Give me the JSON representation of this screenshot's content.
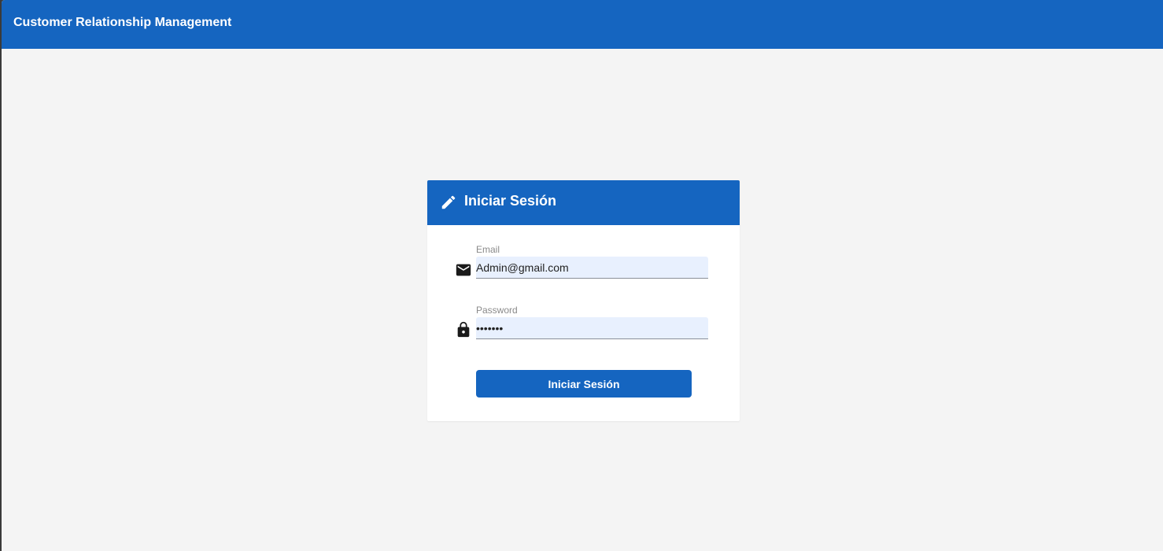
{
  "app": {
    "title": "Customer Relationship Management",
    "accent_color": "#1565c0",
    "background_color": "#f4f4f4"
  },
  "login_card": {
    "title": "Iniciar Sesión",
    "header_icon": "pencil-icon",
    "email": {
      "label": "Email",
      "value": "Admin@gmail.com",
      "icon": "envelope-icon"
    },
    "password": {
      "label": "Password",
      "value": "1234567",
      "icon": "lock-icon"
    },
    "submit_label": "Iniciar Sesión"
  }
}
